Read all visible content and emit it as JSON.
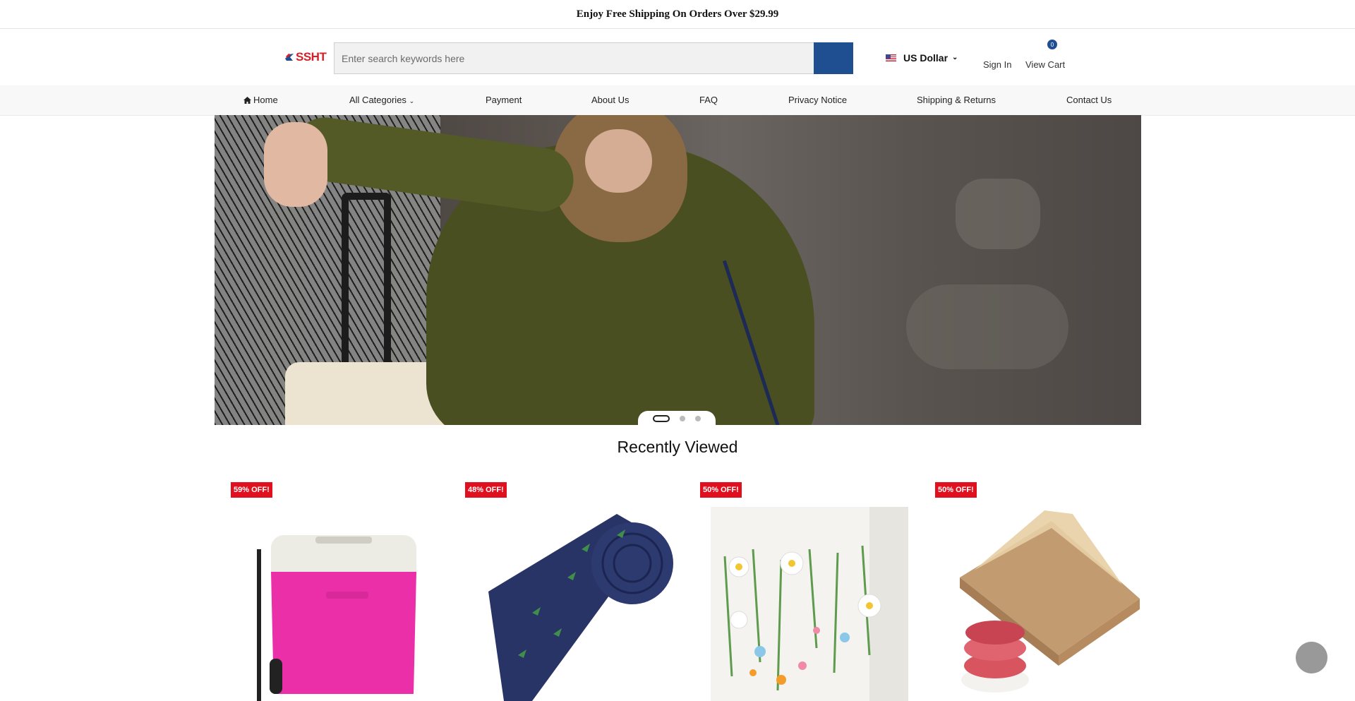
{
  "announcement": "Enjoy Free Shipping On Orders Over $29.99",
  "logo_text": "SSHT",
  "search": {
    "placeholder": "Enter search keywords here"
  },
  "currency": "US Dollar",
  "account": {
    "sign_in": "Sign In",
    "view_cart": "View Cart",
    "cart_count": "0"
  },
  "nav": [
    {
      "label": "Home"
    },
    {
      "label": "All Categories"
    },
    {
      "label": "Payment"
    },
    {
      "label": "About Us"
    },
    {
      "label": "FAQ"
    },
    {
      "label": "Privacy Notice"
    },
    {
      "label": "Shipping & Returns"
    },
    {
      "label": "Contact Us"
    }
  ],
  "slider": {
    "slide_count": 3,
    "active_index": 0
  },
  "recently_viewed": {
    "title": "Recently Viewed",
    "products": [
      {
        "badge": "59% OFF!",
        "image": "pink-rolling-cooler"
      },
      {
        "badge": "48% OFF!",
        "image": "navy-palm-tree-tie"
      },
      {
        "badge": "50% OFF!",
        "image": "paper-flower-garland"
      },
      {
        "badge": "50% OFF!",
        "image": "patty-paper-sheets"
      }
    ]
  },
  "colors": {
    "brand_blue": "#1f4f91",
    "sale_red": "#e0101f",
    "logo_red": "#d6202a"
  }
}
